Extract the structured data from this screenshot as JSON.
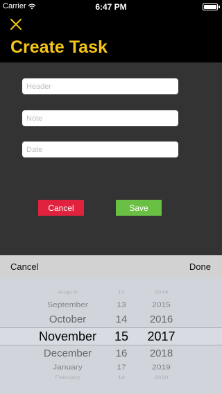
{
  "status_bar": {
    "carrier": "Carrier",
    "time": "6:47 PM"
  },
  "header": {
    "title": "Create Task",
    "accent_color": "#f5c518"
  },
  "form": {
    "header_placeholder": "Header",
    "note_placeholder": "Note",
    "date_placeholder": "Date",
    "cancel_label": "Cancel",
    "save_label": "Save",
    "cancel_color": "#e0223e",
    "save_color": "#6abf45"
  },
  "picker_toolbar": {
    "cancel_label": "Cancel",
    "done_label": "Done"
  },
  "date_picker": {
    "months": [
      "August",
      "September",
      "October",
      "November",
      "December",
      "January",
      "February"
    ],
    "days": [
      "12",
      "13",
      "14",
      "15",
      "16",
      "17",
      "18"
    ],
    "years": [
      "2014",
      "2015",
      "2016",
      "2017",
      "2018",
      "2019",
      "2020"
    ],
    "selected": {
      "month": "November",
      "day": "15",
      "year": "2017"
    }
  }
}
